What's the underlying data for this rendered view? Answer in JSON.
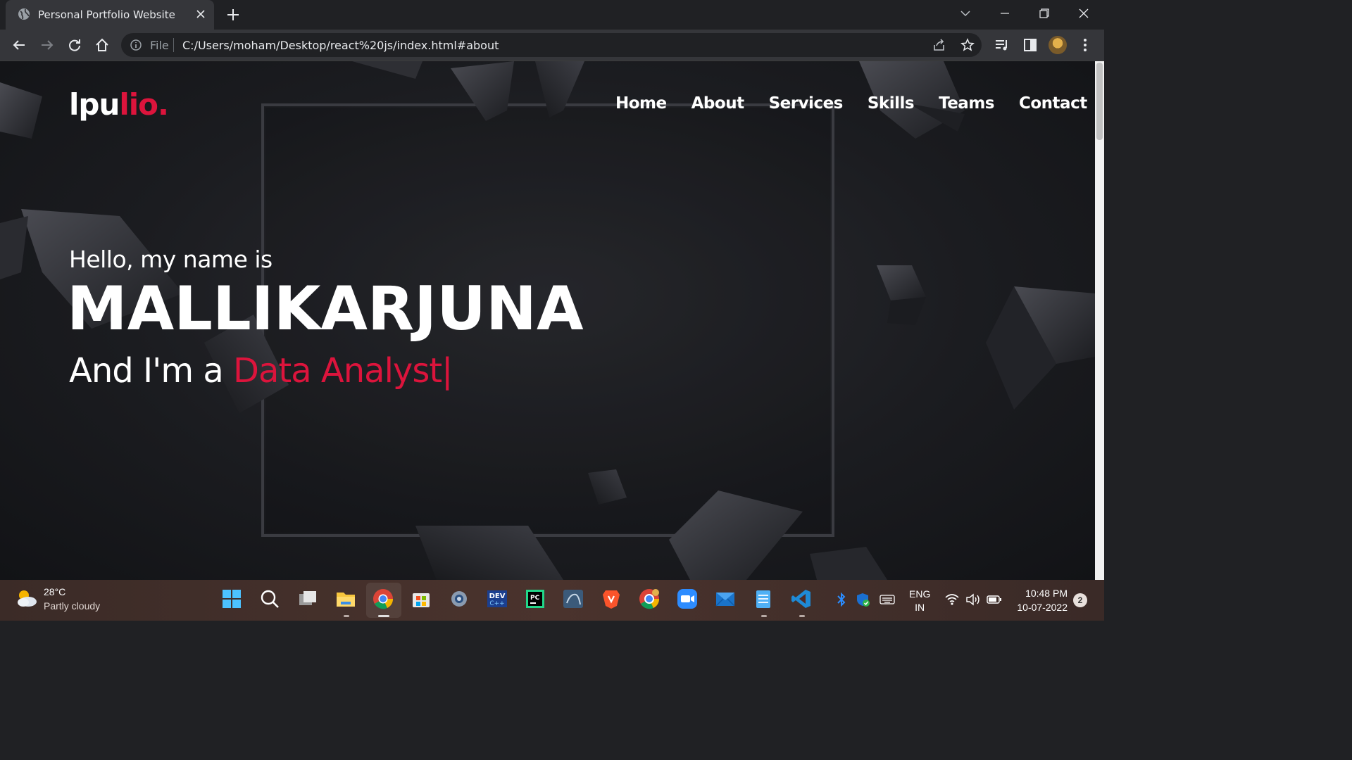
{
  "browser": {
    "tab_title": "Personal Portfolio Website",
    "url_scheme_label": "File",
    "url": "C:/Users/moham/Desktop/react%20js/index.html#about"
  },
  "site": {
    "logo_main": "lpu",
    "logo_accent": "lio.",
    "nav": [
      "Home",
      "About",
      "Services",
      "Skills",
      "Teams",
      "Contact"
    ],
    "greeting": "Hello, my name is",
    "name": "MALLIKARJUNA",
    "role_prefix": "And I'm a ",
    "role_typed": "Data Analyst",
    "cursor": "|",
    "accent_color": "#dc143c"
  },
  "taskbar": {
    "temperature": "28°C",
    "weather": "Partly cloudy",
    "lang_top": "ENG",
    "lang_bottom": "IN",
    "time": "10:48 PM",
    "date": "10-07-2022",
    "notifications": "2"
  }
}
